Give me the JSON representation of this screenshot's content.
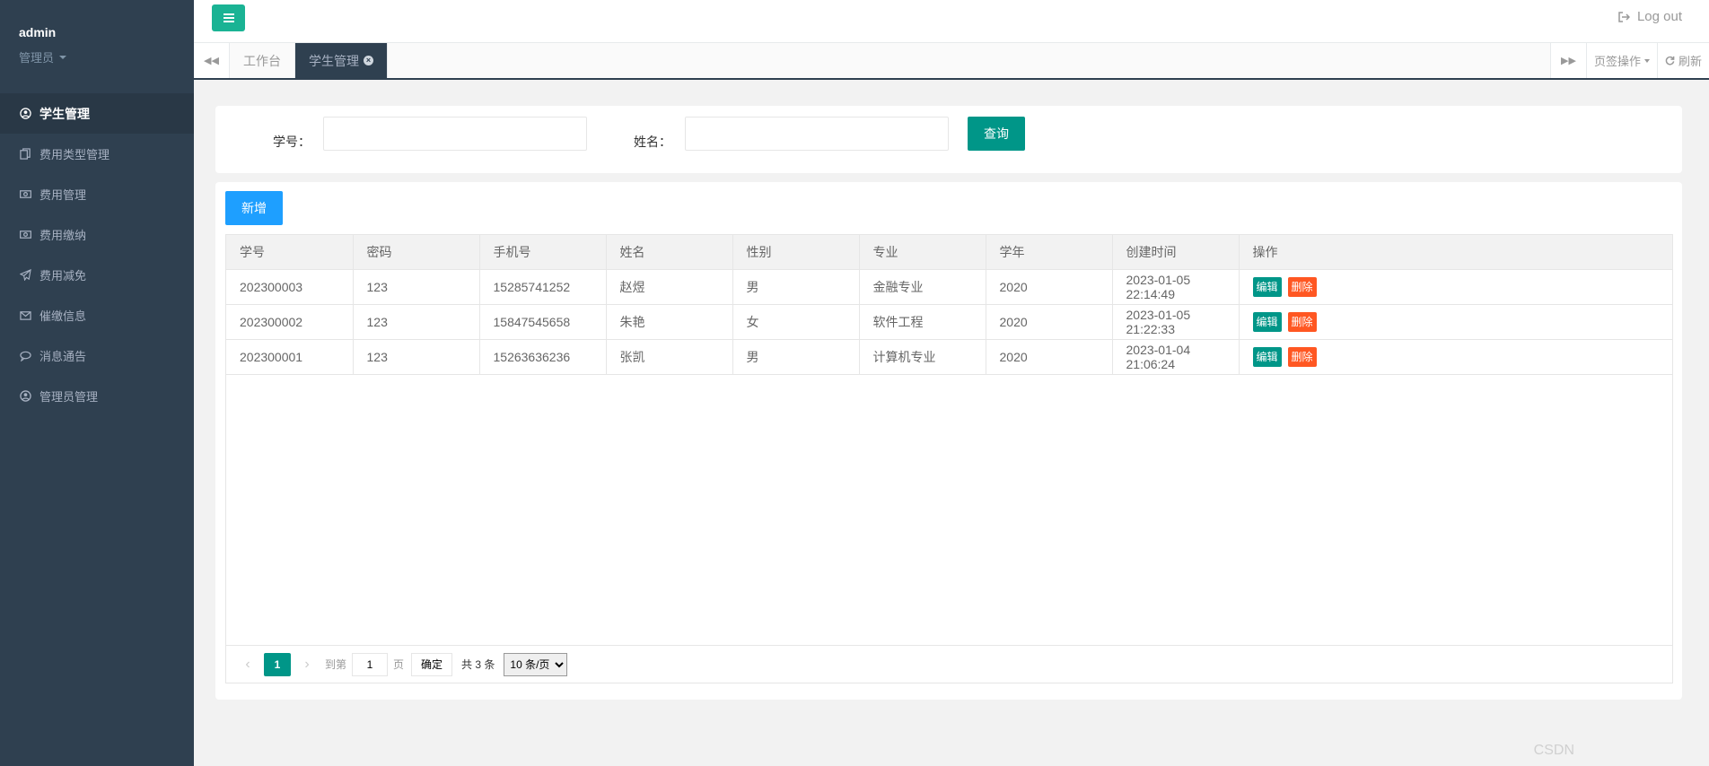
{
  "user": {
    "name": "admin",
    "role": "管理员"
  },
  "menu": [
    {
      "label": "学生管理",
      "icon": "user-circle-icon",
      "active": true
    },
    {
      "label": "费用类型管理",
      "icon": "copy-icon"
    },
    {
      "label": "费用管理",
      "icon": "money-icon"
    },
    {
      "label": "费用缴纳",
      "icon": "money-icon"
    },
    {
      "label": "费用减免",
      "icon": "paper-plane-icon"
    },
    {
      "label": "催缴信息",
      "icon": "envelope-icon"
    },
    {
      "label": "消息通告",
      "icon": "comment-icon"
    },
    {
      "label": "管理员管理",
      "icon": "user-circle-icon"
    }
  ],
  "topbar": {
    "logout": "Log out"
  },
  "tabs": {
    "items": [
      "工作台",
      "学生管理"
    ],
    "active_index": 1,
    "page_ops": "页签操作",
    "refresh": "刷新"
  },
  "search": {
    "id_label": "学号：",
    "name_label": "姓名：",
    "id_value": "",
    "name_value": "",
    "button": "查询"
  },
  "toolbar": {
    "add": "新增"
  },
  "table": {
    "columns": [
      "学号",
      "密码",
      "手机号",
      "姓名",
      "性别",
      "专业",
      "学年",
      "创建时间",
      "操作"
    ],
    "rows": [
      [
        "202300003",
        "123",
        "15285741252",
        "赵煜",
        "男",
        "金融专业",
        "2020",
        "2023-01-05 22:14:49"
      ],
      [
        "202300002",
        "123",
        "15847545658",
        "朱艳",
        "女",
        "软件工程",
        "2020",
        "2023-01-05 21:22:33"
      ],
      [
        "202300001",
        "123",
        "15263636236",
        "张凯",
        "男",
        "计算机专业",
        "2020",
        "2023-01-04 21:06:24"
      ]
    ],
    "edit_label": "编辑",
    "delete_label": "删除"
  },
  "pager": {
    "current": "1",
    "goto_label": "到第",
    "goto_value": "1",
    "page_unit": "页",
    "confirm": "确定",
    "total": "共 3 条",
    "page_size": "10 条/页"
  },
  "colors": {
    "sidebar": "#2f4050",
    "primary": "#009688",
    "add": "#1e9fff",
    "danger": "#ff5722",
    "toggle": "#1ab394"
  }
}
